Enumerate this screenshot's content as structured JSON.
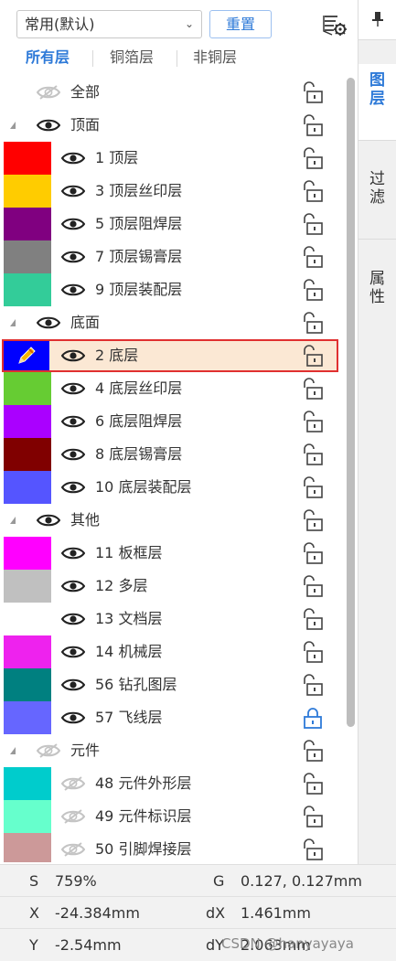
{
  "toolbar": {
    "preset_value": "常用(默认)",
    "reset_label": "重置"
  },
  "filter_tabs": [
    "所有层",
    "铜箔层",
    "非铜层"
  ],
  "side_tabs": {
    "pin": "📌",
    "layers": [
      "图",
      "层"
    ],
    "filter": [
      "过",
      "滤"
    ],
    "properties": [
      "属",
      "性"
    ]
  },
  "layers": [
    {
      "label": "全部",
      "type": "all",
      "visible": false,
      "locked": false
    },
    {
      "label": "顶面",
      "type": "group",
      "visible": true,
      "locked": false
    },
    {
      "label": "1 顶层",
      "color": "#ff0000",
      "visible": true,
      "locked": false
    },
    {
      "label": "3 顶层丝印层",
      "color": "#ffcc00",
      "visible": true,
      "locked": false
    },
    {
      "label": "5 顶层阻焊层",
      "color": "#800080",
      "visible": true,
      "locked": false
    },
    {
      "label": "7 顶层锡膏层",
      "color": "#808080",
      "visible": true,
      "locked": false
    },
    {
      "label": "9 顶层装配层",
      "color": "#33cc99",
      "visible": true,
      "locked": false
    },
    {
      "label": "底面",
      "type": "group",
      "visible": true,
      "locked": false
    },
    {
      "label": "2 底层",
      "color": "#0000ff",
      "visible": true,
      "locked": false,
      "active": true
    },
    {
      "label": "4 底层丝印层",
      "color": "#66cc33",
      "visible": true,
      "locked": false
    },
    {
      "label": "6 底层阻焊层",
      "color": "#aa00ff",
      "visible": true,
      "locked": false
    },
    {
      "label": "8 底层锡膏层",
      "color": "#800000",
      "visible": true,
      "locked": false
    },
    {
      "label": "10 底层装配层",
      "color": "#5555ff",
      "visible": true,
      "locked": false
    },
    {
      "label": "其他",
      "type": "group",
      "visible": true,
      "locked": false
    },
    {
      "label": "11 板框层",
      "color": "#ff00ff",
      "visible": true,
      "locked": false
    },
    {
      "label": "12 多层",
      "color": "#c0c0c0",
      "visible": true,
      "locked": false
    },
    {
      "label": "13 文档层",
      "color": "#ffffff",
      "visible": true,
      "locked": false
    },
    {
      "label": "14 机械层",
      "color": "#ee22ee",
      "visible": true,
      "locked": false
    },
    {
      "label": "56 钻孔图层",
      "color": "#008080",
      "visible": true,
      "locked": false
    },
    {
      "label": "57 飞线层",
      "color": "#6666ff",
      "visible": true,
      "locked": true
    },
    {
      "label": "元件",
      "type": "group",
      "visible": false,
      "locked": false
    },
    {
      "label": "48 元件外形层",
      "color": "#00cccc",
      "visible": false,
      "locked": false
    },
    {
      "label": "49 元件标识层",
      "color": "#66ffcc",
      "visible": false,
      "locked": false
    },
    {
      "label": "50 引脚焊接层",
      "color": "#cc9999",
      "visible": false,
      "locked": false
    }
  ],
  "status": {
    "s_label": "S",
    "s_value": "759%",
    "g_label": "G",
    "g_value": "0.127, 0.127mm",
    "x_label": "X",
    "x_value": "-24.384mm",
    "dx_label": "dX",
    "dx_value": "1.461mm",
    "y_label": "Y",
    "y_value": "-2.54mm",
    "dy_label": "dY",
    "dy_value": "2.063mm"
  },
  "watermark": "CSDN @hanyayaya",
  "colors": {
    "accent": "#2e7ad8",
    "selected_bg": "#fbe8d4",
    "selected_border": "#e03030",
    "lock_active": "#2e7ad8"
  }
}
